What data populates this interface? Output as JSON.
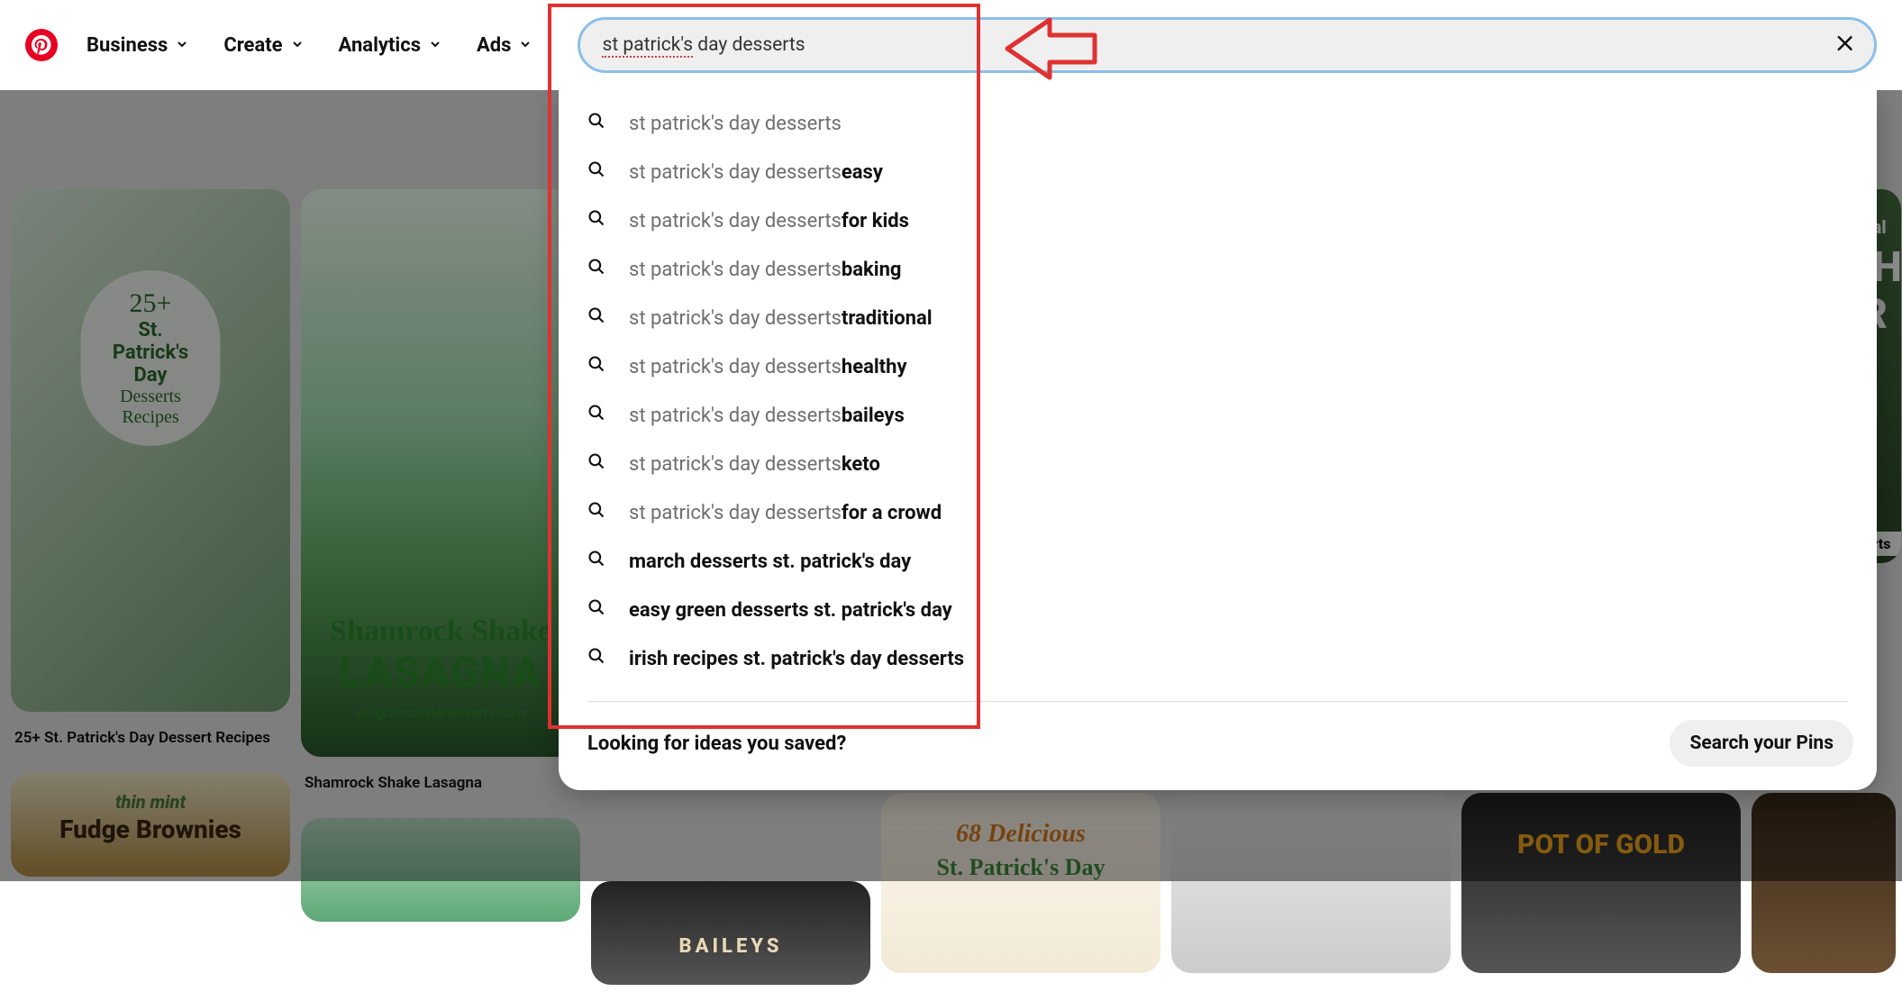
{
  "nav": {
    "business": "Business",
    "create": "Create",
    "analytics": "Analytics",
    "ads": "Ads"
  },
  "search": {
    "query_prefix_underlined": "st patrick's",
    "query_rest": " day desserts"
  },
  "suggestions": [
    {
      "prefix": "st patrick's day desserts",
      "suffix": ""
    },
    {
      "prefix": "st patrick's day desserts ",
      "suffix": "easy"
    },
    {
      "prefix": "st patrick's day desserts ",
      "suffix": "for kids"
    },
    {
      "prefix": "st patrick's day desserts ",
      "suffix": "baking"
    },
    {
      "prefix": "st patrick's day desserts ",
      "suffix": "traditional"
    },
    {
      "prefix": "st patrick's day desserts ",
      "suffix": "healthy"
    },
    {
      "prefix": "st patrick's day desserts ",
      "suffix": "baileys"
    },
    {
      "prefix": "st patrick's day desserts ",
      "suffix": "keto"
    },
    {
      "prefix": "st patrick's day desserts ",
      "suffix": "for a crowd"
    },
    {
      "full_bold": "march desserts st. patrick's day"
    },
    {
      "full_bold": "easy green desserts st. patrick's day"
    },
    {
      "full_bold": "irish recipes st. patrick's day desserts"
    }
  ],
  "dropdown_footer": {
    "label": "Looking for ideas you saved?",
    "button": "Search your Pins"
  },
  "pins": {
    "pin1_caption": "25+ St. Patrick's Day Dessert Recipes",
    "pin1_overlay_top": "25+",
    "pin1_overlay_mid": "St. Patrick's Day",
    "pin1_overlay_bot": "Desserts Recipes",
    "pin2_caption": "Shamrock Shake Lasagna",
    "pin2_overlay_a": "Shamrock Shake",
    "pin2_overlay_b": "LASAGNA",
    "pin2_overlay_c": "omgchocolatedesserts.com",
    "pin4_a": "thin mint",
    "pin4_b": "Fudge Brownies",
    "pin6_label": "BAILEYS",
    "pin7_a": "68 Delicious",
    "pin7_b": "St. Patrick's Day",
    "pin9_a": "POT OF GOLD",
    "pin10_a": "nal",
    "pin10_b": "SH",
    "pin10_c": "R",
    "pin10_d": "serts"
  }
}
